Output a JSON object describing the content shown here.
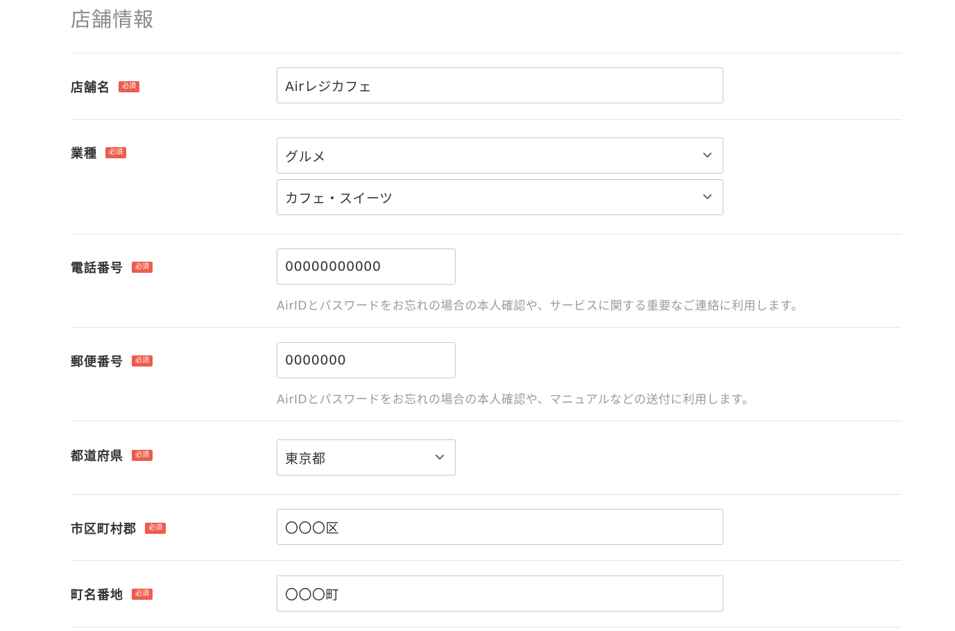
{
  "section": {
    "title": "店舗情報"
  },
  "required_badge": "必須",
  "colors": {
    "badge": "#ef5b4c",
    "border": "#c7c7c7",
    "hint": "#9b9b9b",
    "divider": "#e3e3e3"
  },
  "fields": {
    "store_name": {
      "label": "店舗名",
      "value": "Airレジカフェ"
    },
    "industry": {
      "label": "業種",
      "category": "グルメ",
      "subcategory": "カフェ・スイーツ"
    },
    "phone": {
      "label": "電話番号",
      "value": "00000000000",
      "hint": "AirIDとパスワードをお忘れの場合の本人確認や、サービスに関する重要なご連絡に利用します。"
    },
    "postal": {
      "label": "郵便番号",
      "value": "0000000",
      "hint": "AirIDとパスワードをお忘れの場合の本人確認や、マニュアルなどの送付に利用します。"
    },
    "prefecture": {
      "label": "都道府県",
      "value": "東京都"
    },
    "city": {
      "label": "市区町村郡",
      "value": "〇〇〇区"
    },
    "address": {
      "label": "町名番地",
      "value": "〇〇〇町"
    }
  }
}
